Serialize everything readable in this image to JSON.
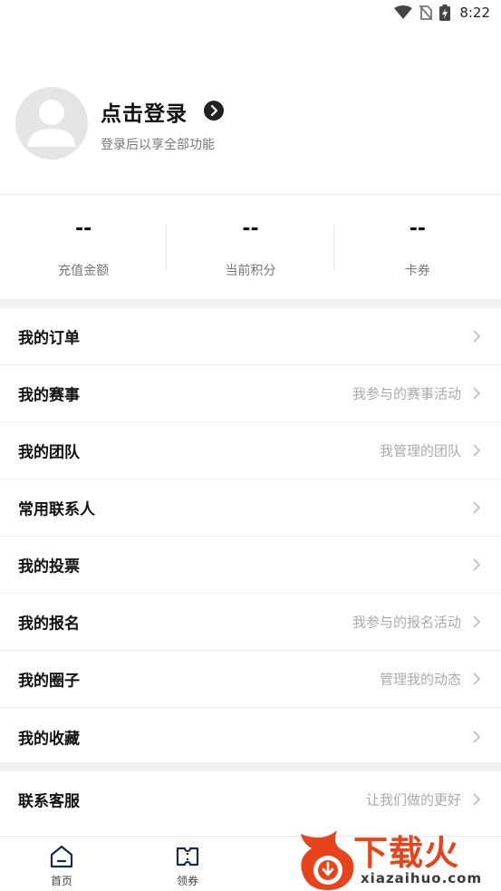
{
  "status_bar": {
    "time": "8:22",
    "icons": [
      "wifi-icon",
      "no-sim-icon",
      "battery-icon"
    ]
  },
  "profile": {
    "title": "点击登录",
    "subtitle": "登录后以享全部功能",
    "avatar_icon": "default-avatar-icon",
    "arrow_icon": "chevron-right-circle-icon"
  },
  "stats": [
    {
      "value": "--",
      "label": "充值金额"
    },
    {
      "value": "--",
      "label": "当前积分"
    },
    {
      "value": "--",
      "label": "卡券"
    }
  ],
  "menu_main": [
    {
      "label": "我的订单",
      "hint": ""
    },
    {
      "label": "我的赛事",
      "hint": "我参与的赛事活动"
    },
    {
      "label": "我的团队",
      "hint": "我管理的团队"
    },
    {
      "label": "常用联系人",
      "hint": ""
    },
    {
      "label": "我的投票",
      "hint": ""
    },
    {
      "label": "我的报名",
      "hint": "我参与的报名活动"
    },
    {
      "label": "我的圈子",
      "hint": "管理我的动态"
    },
    {
      "label": "我的收藏",
      "hint": ""
    }
  ],
  "menu_service": [
    {
      "label": "联系客服",
      "hint": "让我们做的更好"
    }
  ],
  "tabbar": {
    "items": [
      {
        "label": "首页",
        "icon": "home-icon"
      },
      {
        "label": "领券",
        "icon": "ticket-icon"
      }
    ]
  },
  "watermark": {
    "brand": "下载火",
    "domain": "xiazaihuo.com"
  },
  "colors": {
    "accent_text": "#111111",
    "muted": "#777777",
    "hint": "#aaaaaa",
    "band": "#f1f1f1",
    "watermark": "#e8431a"
  }
}
